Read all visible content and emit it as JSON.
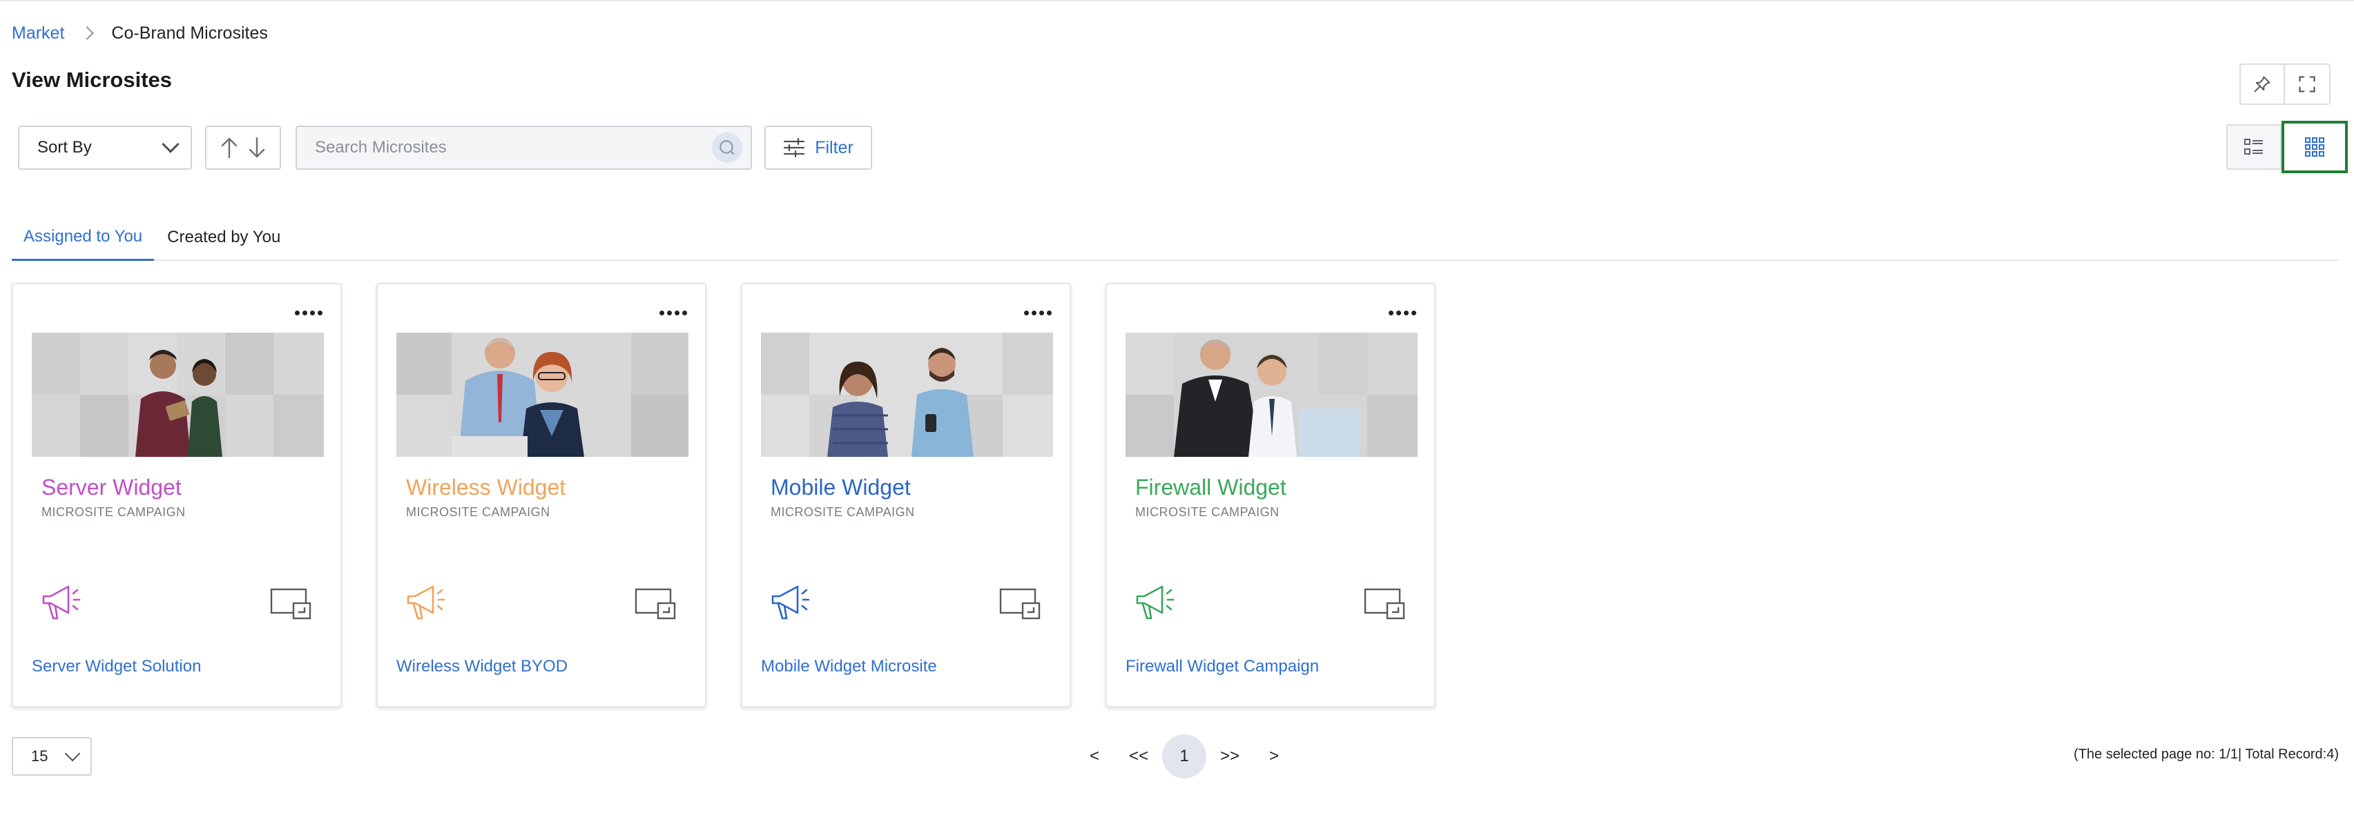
{
  "breadcrumb": {
    "root": "Market",
    "current": "Co-Brand Microsites"
  },
  "page": {
    "title": "View Microsites"
  },
  "toolbar": {
    "sort_label": "Sort By",
    "search_placeholder": "Search Microsites",
    "filter_label": "Filter"
  },
  "tabs": [
    {
      "label": "Assigned to You",
      "active": true
    },
    {
      "label": "Created by You",
      "active": false
    }
  ],
  "cards": [
    {
      "name": "Server Widget",
      "type": "MICROSITE CAMPAIGN",
      "link": "Server Widget Solution",
      "color": "#c04fc8"
    },
    {
      "name": "Wireless Widget",
      "type": "MICROSITE CAMPAIGN",
      "link": "Wireless Widget BYOD",
      "color": "#f0a35a"
    },
    {
      "name": "Mobile Widget",
      "type": "MICROSITE CAMPAIGN",
      "link": "Mobile Widget Microsite",
      "color": "#2a66c9"
    },
    {
      "name": "Firewall Widget",
      "type": "MICROSITE CAMPAIGN",
      "link": "Firewall Widget Campaign",
      "color": "#39a85a"
    }
  ],
  "pagination": {
    "per_page": "15",
    "prev": "<",
    "first": "<<",
    "current_page": "1",
    "last": ">>",
    "next": ">",
    "info": "(The selected page no: 1/1| Total Record:4)"
  },
  "colors": {
    "link": "#2f6fd0",
    "selected_view_outline": "#1e7f34"
  }
}
